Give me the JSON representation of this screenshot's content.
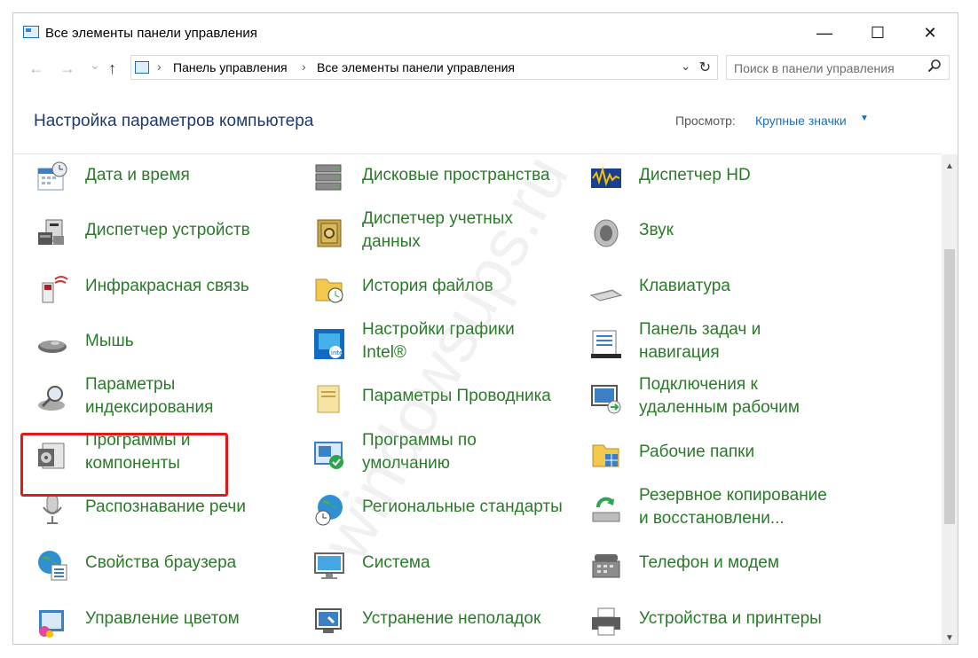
{
  "window": {
    "title": "Все элементы панели управления",
    "minimize": "—",
    "maximize": "☐",
    "close": "✕"
  },
  "nav": {
    "back": "←",
    "forward": "→",
    "recent": "⌄",
    "up": "↑"
  },
  "address": {
    "crumbs": [
      "Панель управления",
      "Все элементы панели управления"
    ],
    "separator": "›",
    "dropdown": "⌄",
    "refresh": "↻"
  },
  "search": {
    "placeholder": "Поиск в панели управления",
    "icon": "search-icon"
  },
  "header": {
    "title": "Настройка параметров компьютера",
    "view_label": "Просмотр:",
    "view_value": "Крупные значки",
    "view_caret": "▼"
  },
  "colors": {
    "item_text": "#2a7a2a",
    "heading": "#1e3a6e",
    "link": "#1a6fbf",
    "highlight": "#e01919"
  },
  "columns": [
    [
      {
        "name": "date-time",
        "icon": "calendar-clock-icon",
        "lines": [
          "Дата и время"
        ]
      },
      {
        "name": "device-manager",
        "icon": "device-manager-icon",
        "lines": [
          "Диспетчер устройств"
        ]
      },
      {
        "name": "infrared",
        "icon": "infrared-icon",
        "lines": [
          "Инфракрасная связь"
        ]
      },
      {
        "name": "mouse",
        "icon": "mouse-icon",
        "lines": [
          "Мышь"
        ]
      },
      {
        "name": "indexing",
        "icon": "indexing-icon",
        "lines": [
          "Параметры",
          "индексирования"
        ]
      },
      {
        "name": "programs-features",
        "icon": "programs-features-icon",
        "lines": [
          "Программы и",
          "компоненты"
        ]
      },
      {
        "name": "speech",
        "icon": "microphone-icon",
        "lines": [
          "Распознавание речи"
        ]
      },
      {
        "name": "internet-options",
        "icon": "globe-list-icon",
        "lines": [
          "Свойства браузера"
        ]
      },
      {
        "name": "color-management",
        "icon": "color-management-icon",
        "lines": [
          "Управление цветом"
        ]
      }
    ],
    [
      {
        "name": "storage-spaces",
        "icon": "storage-spaces-icon",
        "lines": [
          "Дисковые пространства"
        ]
      },
      {
        "name": "credential-manager",
        "icon": "safe-icon",
        "lines": [
          "Диспетчер учетных",
          "данных"
        ]
      },
      {
        "name": "file-history",
        "icon": "file-history-icon",
        "lines": [
          "История файлов"
        ]
      },
      {
        "name": "intel-graphics",
        "icon": "intel-graphics-icon",
        "lines": [
          "Настройки графики",
          "Intel®"
        ]
      },
      {
        "name": "explorer-options",
        "icon": "folder-options-icon",
        "lines": [
          "Параметры Проводника"
        ]
      },
      {
        "name": "default-programs",
        "icon": "default-programs-icon",
        "lines": [
          "Программы по",
          "умолчанию"
        ]
      },
      {
        "name": "region",
        "icon": "globe-clock-icon",
        "lines": [
          "Региональные стандарты"
        ]
      },
      {
        "name": "system",
        "icon": "monitor-icon",
        "lines": [
          "Система"
        ]
      },
      {
        "name": "troubleshooting",
        "icon": "troubleshoot-icon",
        "lines": [
          "Устранение неполадок"
        ]
      }
    ],
    [
      {
        "name": "hd-audio",
        "icon": "hd-audio-icon",
        "lines": [
          "Диспетчер HD"
        ]
      },
      {
        "name": "sound",
        "icon": "speaker-icon",
        "lines": [
          "Звук"
        ]
      },
      {
        "name": "keyboard",
        "icon": "keyboard-icon",
        "lines": [
          "Клавиатура"
        ]
      },
      {
        "name": "taskbar",
        "icon": "taskbar-icon",
        "lines": [
          "Панель задач и",
          "навигация"
        ]
      },
      {
        "name": "remote-app",
        "icon": "remote-desktop-icon",
        "lines": [
          "Подключения к",
          "удаленным рабочим"
        ]
      },
      {
        "name": "work-folders",
        "icon": "work-folders-icon",
        "lines": [
          "Рабочие папки"
        ]
      },
      {
        "name": "backup-restore",
        "icon": "backup-icon",
        "lines": [
          "Резервное копирование",
          "и восстановлени..."
        ]
      },
      {
        "name": "phone-modem",
        "icon": "phone-icon",
        "lines": [
          "Телефон и модем"
        ]
      },
      {
        "name": "devices-printers",
        "icon": "printer-icon",
        "lines": [
          "Устройства и принтеры"
        ]
      }
    ]
  ],
  "scrollbar": {
    "up": "▲",
    "down": "▼"
  },
  "watermark": "windowsups.ru"
}
